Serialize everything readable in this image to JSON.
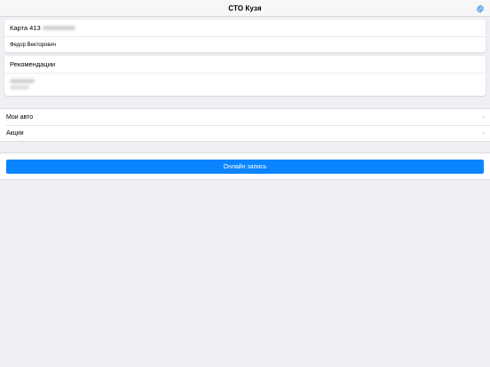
{
  "navbar": {
    "title": "СТО Кузя",
    "settings_icon": "gear-icon",
    "accent_color": "#2e8bf0"
  },
  "card_account": {
    "title_prefix": "Карта 413",
    "owner_name": "Федор Векторович"
  },
  "card_recommendations": {
    "title": "Рекомендации"
  },
  "menu": {
    "items": [
      {
        "label": "Мои авто",
        "icon": "chevron-right-icon"
      },
      {
        "label": "Акции",
        "icon": "chevron-right-icon"
      }
    ]
  },
  "actions": {
    "online_booking_label": "Онлайн запись",
    "button_color": "#0a84ff"
  }
}
